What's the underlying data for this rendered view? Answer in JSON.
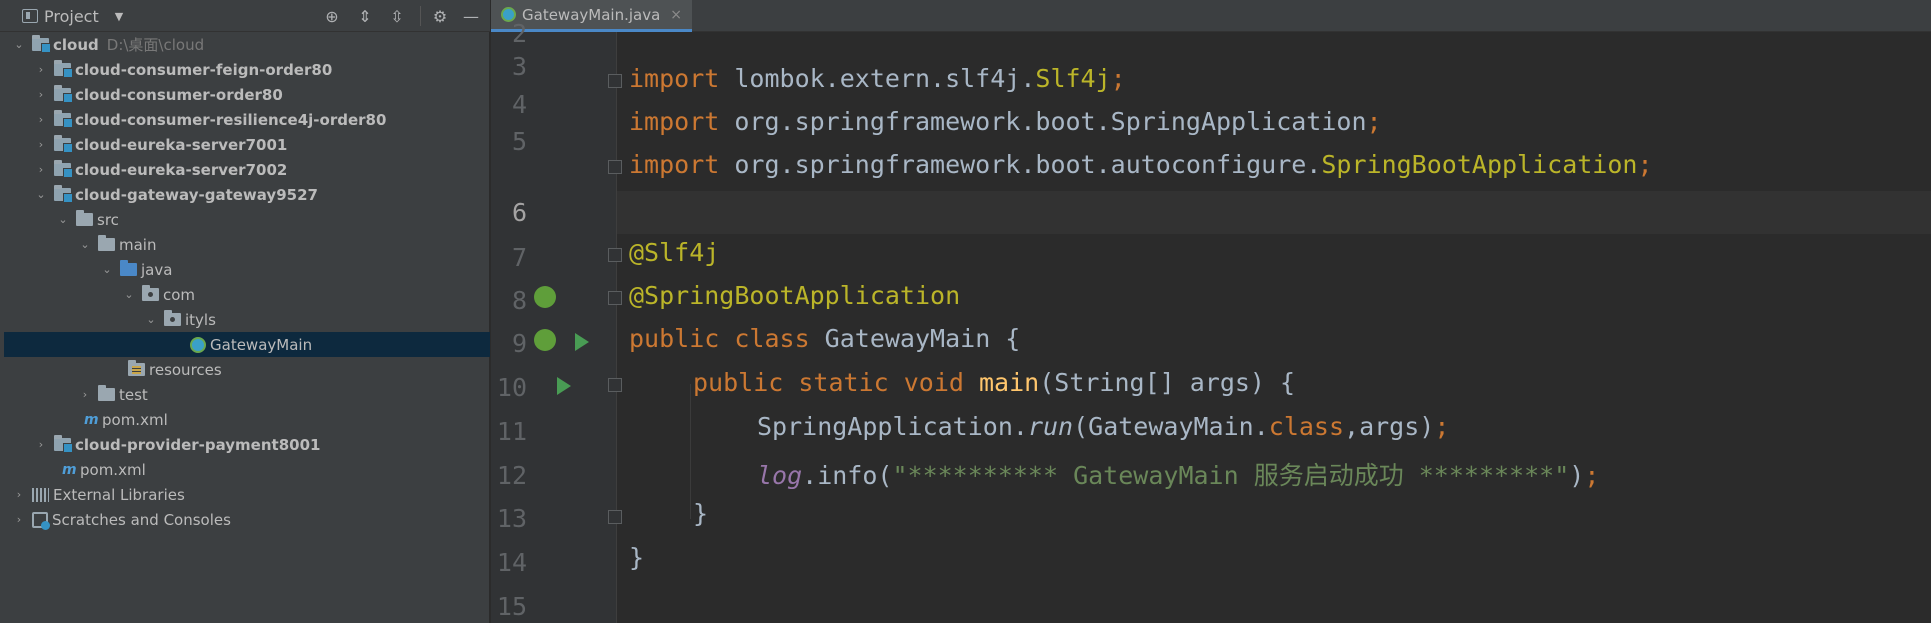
{
  "project_panel": {
    "title": "Project",
    "toolbar": [
      "locate-icon",
      "expand-all-icon",
      "collapse-all-icon",
      "gear-icon",
      "minimize-icon"
    ],
    "tree": [
      {
        "label": "cloud",
        "hint": "D:\\桌面\\cloud",
        "bold": true,
        "icon": "module-folder-icon",
        "expanded": true
      },
      {
        "label": "cloud-consumer-feign-order80",
        "bold": true,
        "icon": "module-folder-icon",
        "expanded": false
      },
      {
        "label": "cloud-consumer-order80",
        "bold": true,
        "icon": "module-folder-icon",
        "expanded": false
      },
      {
        "label": "cloud-consumer-resilience4j-order80",
        "bold": true,
        "icon": "module-folder-icon",
        "expanded": false
      },
      {
        "label": "cloud-eureka-server7001",
        "bold": true,
        "icon": "module-folder-icon",
        "expanded": false
      },
      {
        "label": "cloud-eureka-server7002",
        "bold": true,
        "icon": "module-folder-icon",
        "expanded": false
      },
      {
        "label": "cloud-gateway-gateway9527",
        "bold": true,
        "icon": "module-folder-icon",
        "expanded": true
      },
      {
        "label": "src",
        "icon": "folder-icon",
        "expanded": true
      },
      {
        "label": "main",
        "icon": "folder-icon",
        "expanded": true
      },
      {
        "label": "java",
        "icon": "source-folder-icon",
        "expanded": true
      },
      {
        "label": "com",
        "icon": "package-icon",
        "expanded": true
      },
      {
        "label": "ityls",
        "icon": "package-icon",
        "expanded": true
      },
      {
        "label": "GatewayMain",
        "icon": "class-icon",
        "selected": true
      },
      {
        "label": "resources",
        "icon": "resources-folder-icon"
      },
      {
        "label": "test",
        "icon": "folder-icon",
        "expanded": false
      },
      {
        "label": "pom.xml",
        "icon": "maven-icon"
      },
      {
        "label": "cloud-provider-payment8001",
        "bold": true,
        "icon": "module-folder-icon",
        "expanded": false
      },
      {
        "label": "pom.xml",
        "icon": "maven-icon"
      },
      {
        "label": "External Libraries",
        "icon": "libraries-icon",
        "expanded": false
      },
      {
        "label": "Scratches and Consoles",
        "icon": "scratches-icon",
        "expanded": false
      }
    ]
  },
  "editor": {
    "tab": {
      "label": "GatewayMain.java",
      "close": "×"
    },
    "line_numbers": [
      "2",
      "3",
      "4",
      "5",
      "6",
      "7",
      "8",
      "9",
      "10",
      "11",
      "12",
      "13",
      "14",
      "15"
    ],
    "current_line": "6",
    "code": {
      "l3_kw": "import",
      "l3_pkg": " lombok.extern.slf4j.",
      "l3_cls": "Slf4j",
      "l3_semi": ";",
      "l4_kw": "import",
      "l4_pkg": " org.springframework.boot.SpringApplication",
      "l4_semi": ";",
      "l5_kw": "import",
      "l5_pkg": " org.springframework.boot.autoconfigure.",
      "l5_cls": "SpringBootApplication",
      "l5_semi": ";",
      "l7_ann": "@Slf4j",
      "l8_ann": "@SpringBootApplication",
      "l9_kw": "public class",
      "l9_rest": " GatewayMain {",
      "l10_kw": "public static void",
      "l10_fn": "main",
      "l10_rest": "(String[] args) {",
      "l11_a": "SpringApplication.",
      "l11_run": "run",
      "l11_b": "(GatewayMain.",
      "l11_class": "class",
      "l11_c": ",args)",
      "l11_semi": ";",
      "l12_log": "log",
      "l12_a": ".info(",
      "l12_str": "\"********** GatewayMain 服务启动成功 *********\"",
      "l12_b": ")",
      "l12_semi": ";",
      "l13": "}",
      "l14": "}"
    }
  },
  "colors": {
    "keyword": "#cc7832",
    "annotation": "#bbb529",
    "string": "#6a8759",
    "field": "#9876aa",
    "method": "#ffc66d",
    "text": "#a9b7c6",
    "selection": "#0d293e"
  }
}
